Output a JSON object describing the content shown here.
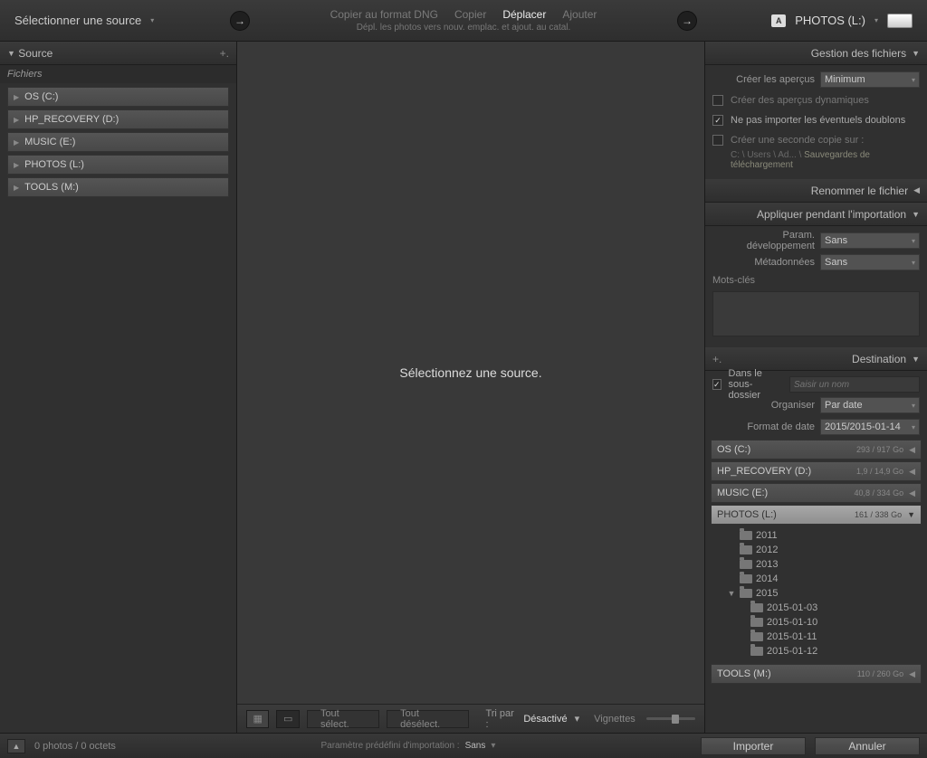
{
  "top": {
    "source_label": "Sélectionner une source",
    "actions": {
      "copy_dng": "Copier au format DNG",
      "copy": "Copier",
      "move": "Déplacer",
      "add": "Ajouter"
    },
    "subtitle": "Dépl. les photos vers nouv. emplac. et ajout. au catal.",
    "dest_badge": "A",
    "dest_label": "PHOTOS (L:)"
  },
  "left": {
    "panel_title": "Source",
    "files_label": "Fichiers",
    "drives": [
      {
        "label": "OS (C:)"
      },
      {
        "label": "HP_RECOVERY (D:)"
      },
      {
        "label": "MUSIC (E:)"
      },
      {
        "label": "PHOTOS (L:)"
      },
      {
        "label": "TOOLS (M:)"
      }
    ]
  },
  "center": {
    "empty_msg": "Sélectionnez une source.",
    "select_all": "Tout sélect.",
    "deselect_all": "Tout désélect.",
    "sort_label": "Tri par :",
    "sort_value": "Désactivé",
    "thumbnails_label": "Vignettes"
  },
  "right": {
    "file_handling": {
      "title": "Gestion des fichiers",
      "build_previews_label": "Créer les aperçus",
      "build_previews_value": "Minimum",
      "build_smart": "Créer des aperçus dynamiques",
      "no_duplicates": "Ne pas importer les éventuels doublons",
      "second_copy": "Créer une seconde copie sur :",
      "second_copy_path_prefix": "C: \\ Users \\ Ad... \\ ",
      "second_copy_path_hl": "Sauvegardes de téléchargement"
    },
    "rename_title": "Renommer le fichier",
    "apply_title": "Appliquer pendant l'importation",
    "apply": {
      "dev_label": "Param. développement",
      "dev_value": "Sans",
      "meta_label": "Métadonnées",
      "meta_value": "Sans",
      "keywords_label": "Mots-clés"
    },
    "destination": {
      "title": "Destination",
      "in_subfolder": "Dans le sous-dossier",
      "subfolder_placeholder": "Saisir un nom",
      "organize_label": "Organiser",
      "organize_value": "Par date",
      "date_format_label": "Format de date",
      "date_format_value": "2015/2015-01-14",
      "drives": [
        {
          "label": "OS (C:)",
          "size": "293 / 917 Go"
        },
        {
          "label": "HP_RECOVERY (D:)",
          "size": "1,9 / 14,9 Go"
        },
        {
          "label": "MUSIC (E:)",
          "size": "40,8 / 334 Go"
        },
        {
          "label": "PHOTOS (L:)",
          "size": "161 / 338 Go"
        },
        {
          "label": "TOOLS (M:)",
          "size": "110 / 260 Go"
        }
      ],
      "folders_l1": [
        "2011",
        "2012",
        "2013",
        "2014",
        "2015"
      ],
      "folders_l2": [
        "2015-01-03",
        "2015-01-10",
        "2015-01-11",
        "2015-01-12"
      ]
    }
  },
  "bottom": {
    "status": "0 photos / 0 octets",
    "preset_label": "Paramètre prédéfini d'importation :",
    "preset_value": "Sans",
    "import_btn": "Importer",
    "cancel_btn": "Annuler"
  }
}
